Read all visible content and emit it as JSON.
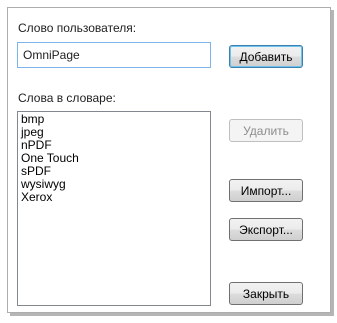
{
  "dialog": {
    "user_word_label": "Слово пользователя:",
    "user_word_value": "OmniPage",
    "dictionary_label": "Слова в словаре:",
    "dictionary_words": [
      "bmp",
      "jpeg",
      "nPDF",
      "One Touch",
      "sPDF",
      "wysiwyg",
      "Xerox"
    ],
    "buttons": {
      "add": "Добавить",
      "delete": "Удалить",
      "import": "Импорт...",
      "export": "Экспорт...",
      "close": "Закрыть"
    },
    "delete_enabled": false
  }
}
